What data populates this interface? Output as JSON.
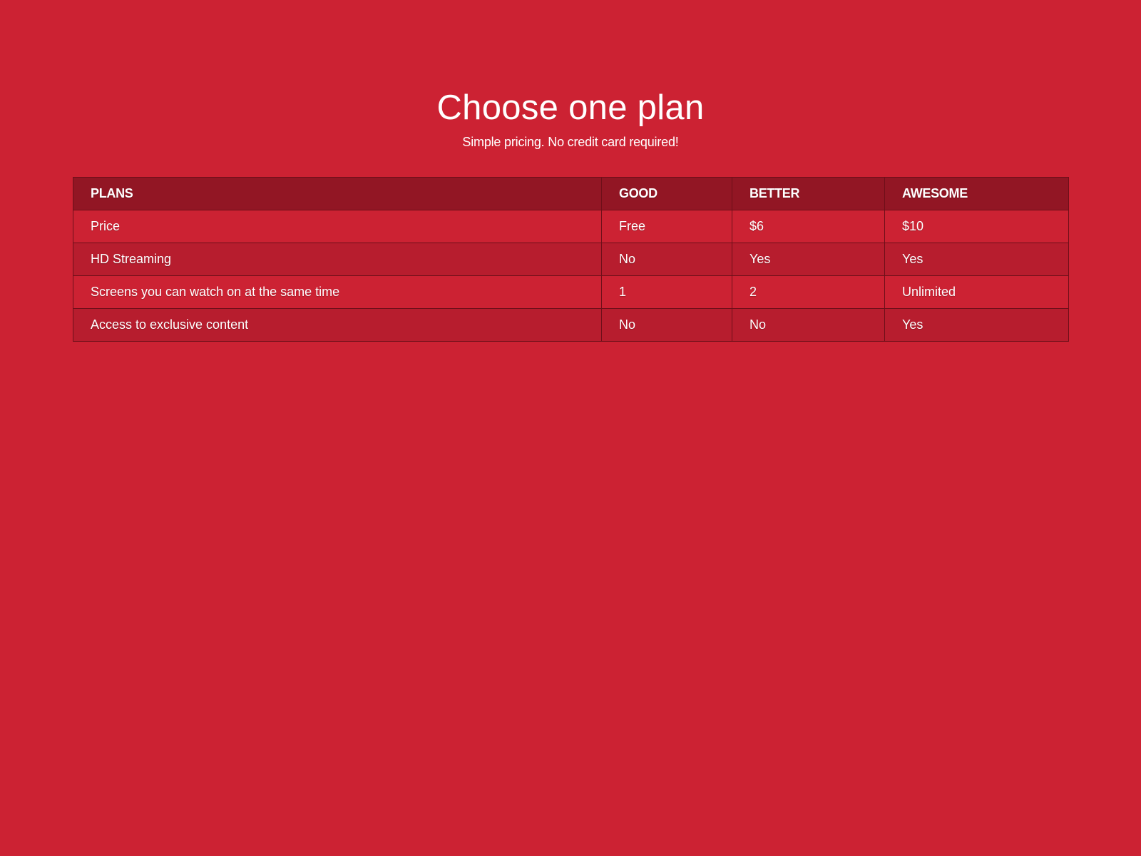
{
  "header": {
    "title": "Choose one plan",
    "subtitle": "Simple pricing. No credit card required!"
  },
  "plans_table": {
    "columns": [
      "PLANS",
      "GOOD",
      "BETTER",
      "AWESOME"
    ],
    "rows": [
      [
        "Price",
        "Free",
        "$6",
        "$10"
      ],
      [
        "HD Streaming",
        "No",
        "Yes",
        "Yes"
      ],
      [
        "Screens you can watch on at the same time",
        "1",
        "2",
        "Unlimited"
      ],
      [
        "Access to exclusive content",
        "No",
        "No",
        "Yes"
      ]
    ]
  },
  "colors": {
    "background": "#cc2233",
    "header_row": "#921624",
    "alt_row": "#b71d2e",
    "border": "#6e0f19",
    "text": "#ffffff"
  }
}
